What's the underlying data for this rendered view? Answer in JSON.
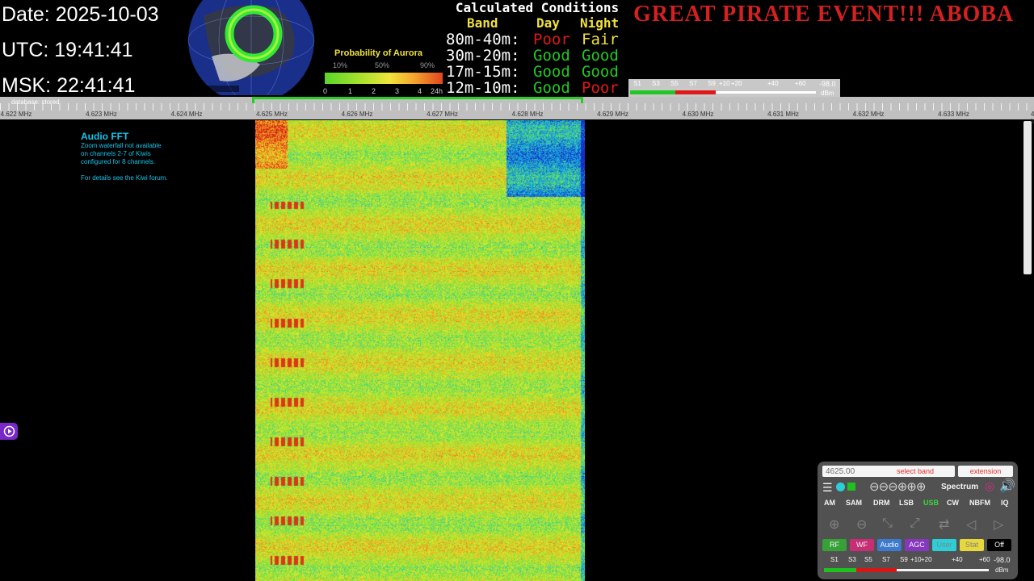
{
  "clock": {
    "date": "Date: 2025-10-03",
    "utc": "UTC: 19:41:41",
    "msk": "MSK: 22:41:41"
  },
  "aurora": {
    "title": "Probability of Aurora",
    "percent_labels": [
      "10%",
      "50%",
      "90%"
    ],
    "kp_labels": [
      "0",
      "1",
      "2",
      "3",
      "4",
      "24h"
    ]
  },
  "conditions": {
    "title": "Calculated Conditions",
    "headers": {
      "band": "Band",
      "day": "Day",
      "night": "Night"
    },
    "rows": [
      {
        "band": "80m-40m:",
        "day": "Poor",
        "night": "Fair"
      },
      {
        "band": "30m-20m:",
        "day": "Good",
        "night": "Good"
      },
      {
        "band": "17m-15m:",
        "day": "Good",
        "night": "Good"
      },
      {
        "band": "12m-10m:",
        "day": "Good",
        "night": "Poor"
      }
    ],
    "colors": {
      "Poor": "#e01818",
      "Fair": "#f0e040",
      "Good": "#22c822"
    }
  },
  "event_banner": "GREAT PIRATE EVENT!!! ABOBA",
  "smeter": {
    "labels": [
      "S1",
      "S3",
      "S5",
      "S7",
      "S9",
      "+10",
      "+20",
      "+40",
      "+60"
    ],
    "value": "-98.0",
    "unit": "dBm"
  },
  "scale": {
    "database_status": "database: stored",
    "freq_labels": [
      "4.622 MHz",
      "4.623 MHz",
      "4.624 MHz",
      "4.625 MHz",
      "4.626 MHz",
      "4.627 MHz",
      "4.628 MHz",
      "4.629 MHz",
      "4.630 MHz",
      "4.631 MHz",
      "4.632 MHz",
      "4.633 MHz",
      "4.634 MHz"
    ]
  },
  "fft_note": {
    "title": "Audio FFT",
    "lines": [
      "Zoom waterfall not available",
      "on channels 2-7 of Kiwis",
      "configured for 8 channels."
    ],
    "details": "For details see the Kiwi forum."
  },
  "panel": {
    "freq_value": "4625.00",
    "band_placeholder": "select band",
    "extension_placeholder": "extension",
    "spectrum_label": "Spectrum",
    "modes": [
      "AM",
      "SAM",
      "DRM",
      "LSB",
      "USB",
      "CW",
      "NBFM",
      "IQ"
    ],
    "active_mode": "USB",
    "buttons": [
      {
        "label": "RF",
        "color": "#3aa83a"
      },
      {
        "label": "WF",
        "color": "#d0307a"
      },
      {
        "label": "Audio",
        "color": "#3f7fd8"
      },
      {
        "label": "AGC",
        "color": "#8c3ac8"
      },
      {
        "label": "User",
        "color": "#2ed8e0"
      },
      {
        "label": "Stat",
        "color": "#f0e040"
      },
      {
        "label": "Off",
        "color": "#000000"
      }
    ]
  }
}
